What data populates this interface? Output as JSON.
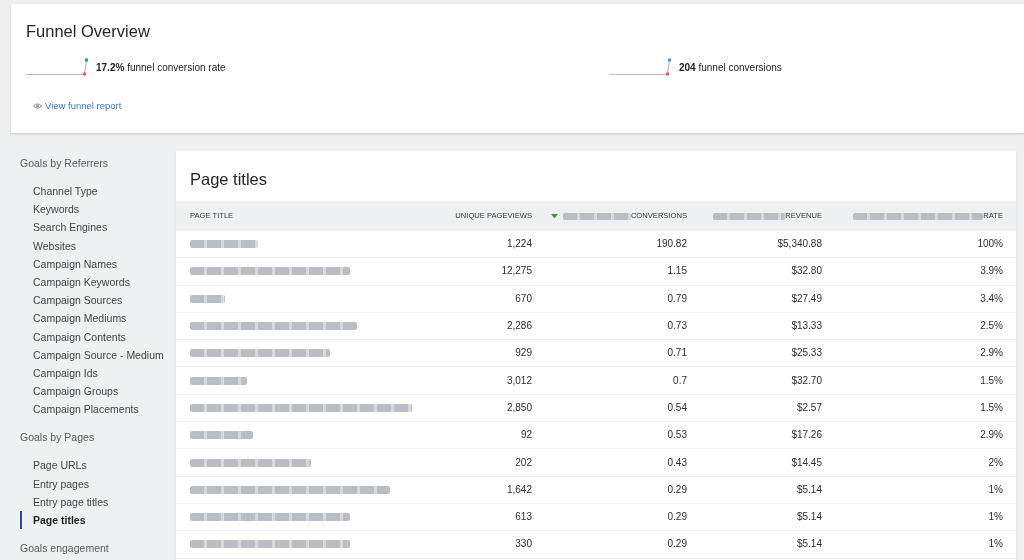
{
  "overview": {
    "title": "Funnel Overview",
    "metrics": [
      {
        "text": "**17.2%** funnel conversion rate"
      },
      {
        "text": "**204** funnel conversions"
      }
    ],
    "report_link": "View funnel report"
  },
  "sidebar": {
    "groups": [
      {
        "title": "Goals by Referrers",
        "items": [
          {
            "label": "Channel Type",
            "selected": false
          },
          {
            "label": "Keywords",
            "selected": false
          },
          {
            "label": "Search Engines",
            "selected": false
          },
          {
            "label": "Websites",
            "selected": false
          },
          {
            "label": "Campaign Names",
            "selected": false
          },
          {
            "label": "Campaign Keywords",
            "selected": false
          },
          {
            "label": "Campaign Sources",
            "selected": false
          },
          {
            "label": "Campaign Mediums",
            "selected": false
          },
          {
            "label": "Campaign Contents",
            "selected": false
          },
          {
            "label": "Campaign Source - Medium",
            "selected": false
          },
          {
            "label": "Campaign Ids",
            "selected": false
          },
          {
            "label": "Campaign Groups",
            "selected": false
          },
          {
            "label": "Campaign Placements",
            "selected": false
          }
        ]
      },
      {
        "title": "Goals by Pages",
        "items": [
          {
            "label": "Page URLs",
            "selected": false
          },
          {
            "label": "Entry pages",
            "selected": false
          },
          {
            "label": "Entry page titles",
            "selected": false
          },
          {
            "label": "Page titles",
            "selected": true
          }
        ]
      },
      {
        "title": "Goals engagement"
      }
    ]
  },
  "table": {
    "title": "Page titles",
    "columns": [
      {
        "label": "PAGE TITLE",
        "blurred_prefix": false,
        "sorted": false
      },
      {
        "label": "UNIQUE PAGEVIEWS",
        "blurred_prefix": false,
        "sorted": false
      },
      {
        "label": "CONVERSIONS",
        "blurred_prefix": true,
        "sorted": true
      },
      {
        "label": "REVENUE",
        "blurred_prefix": true,
        "sorted": false
      },
      {
        "label": "RATE",
        "blurred_prefix": true,
        "sorted": false
      }
    ],
    "rows": [
      {
        "title_blurred": true,
        "cells": [
          "",
          "1,224",
          "190.82",
          "$5,340.88",
          "100%"
        ]
      },
      {
        "title_blurred": true,
        "cells": [
          "",
          "12,275",
          "1.15",
          "$32.80",
          "3.9%"
        ]
      },
      {
        "title_blurred": true,
        "cells": [
          "",
          "670",
          "0.79",
          "$27.49",
          "3.4%"
        ]
      },
      {
        "title_blurred": true,
        "cells": [
          "",
          "2,286",
          "0.73",
          "$13.33",
          "2.5%"
        ]
      },
      {
        "title_blurred": true,
        "cells": [
          "",
          "929",
          "0.71",
          "$25.33",
          "2.9%"
        ]
      },
      {
        "title_blurred": true,
        "cells": [
          "",
          "3,012",
          "0.7",
          "$32.70",
          "1.5%"
        ]
      },
      {
        "title_blurred": true,
        "cells": [
          "",
          "2,850",
          "0.54",
          "$2.57",
          "1.5%"
        ]
      },
      {
        "title_blurred": true,
        "cells": [
          "",
          "92",
          "0.53",
          "$17.26",
          "2.9%"
        ]
      },
      {
        "title_blurred": true,
        "cells": [
          "",
          "202",
          "0.43",
          "$14.45",
          "2%"
        ]
      },
      {
        "title_blurred": true,
        "cells": [
          "",
          "1,642",
          "0.29",
          "$5.14",
          "1%"
        ]
      },
      {
        "title_blurred": true,
        "cells": [
          "",
          "613",
          "0.29",
          "$5.14",
          "1%"
        ]
      },
      {
        "title_blurred": true,
        "cells": [
          "",
          "330",
          "0.29",
          "$5.14",
          "1%"
        ]
      }
    ]
  }
}
